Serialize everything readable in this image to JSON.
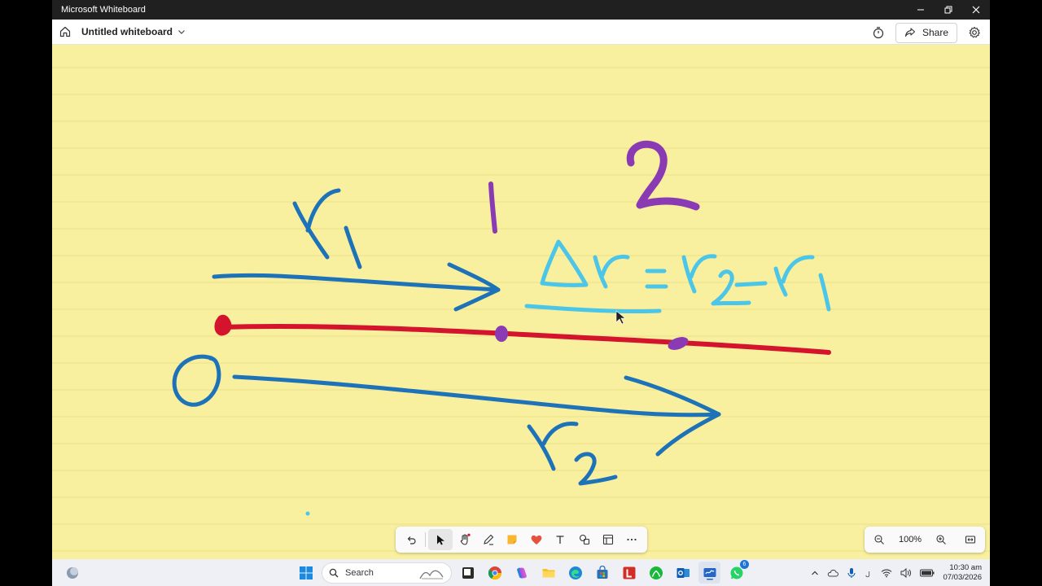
{
  "window": {
    "app_title": "Microsoft Whiteboard",
    "minimize_icon": "minimize-icon",
    "restore_icon": "restore-icon",
    "close_icon": "close-icon"
  },
  "appbar": {
    "home_icon": "home-icon",
    "board_name": "Untitled whiteboard",
    "timer_icon": "timer-icon",
    "share_label": "Share",
    "settings_icon": "gear-icon"
  },
  "canvas": {
    "background_color": "#f8ef9f",
    "line_color": "#ece28a",
    "strokes": [
      {
        "name": "r1-label",
        "color": "#1e73b8",
        "text": "r1"
      },
      {
        "name": "r1-arrow",
        "color": "#1e73b8"
      },
      {
        "name": "origin-dot",
        "color": "#d3142c"
      },
      {
        "name": "path-line",
        "color": "#d3142c"
      },
      {
        "name": "point-1-dot",
        "color": "#8a3bb4"
      },
      {
        "name": "point-2-dot",
        "color": "#8a3bb4"
      },
      {
        "name": "label-1",
        "color": "#8a3bb4",
        "text": "1"
      },
      {
        "name": "label-2",
        "color": "#8a3bb4",
        "text": "2"
      },
      {
        "name": "delta-r-equation",
        "color": "#4cc6e8",
        "text": "Δr = r2 - r1"
      },
      {
        "name": "origin-label",
        "color": "#1e73b8",
        "text": "O"
      },
      {
        "name": "r2-arrow",
        "color": "#1e73b8"
      },
      {
        "name": "r2-label",
        "color": "#1e73b8",
        "text": "r2"
      }
    ]
  },
  "toolbar": {
    "tools": [
      "undo",
      "select",
      "pan",
      "pen",
      "sticky-note",
      "reactions",
      "text",
      "shapes",
      "templates",
      "more"
    ],
    "active_tool": "select"
  },
  "zoom": {
    "level": "100%"
  },
  "taskbar": {
    "search_placeholder": "Search",
    "apps": [
      "start",
      "search",
      "file-explorer-dark",
      "chrome",
      "copilot",
      "file-explorer",
      "edge",
      "store",
      "lastpass",
      "xbox",
      "outlook",
      "whiteboard",
      "whatsapp"
    ],
    "whatsapp_badge": "6",
    "time": "10:30 am",
    "date": "07/03/2026"
  }
}
